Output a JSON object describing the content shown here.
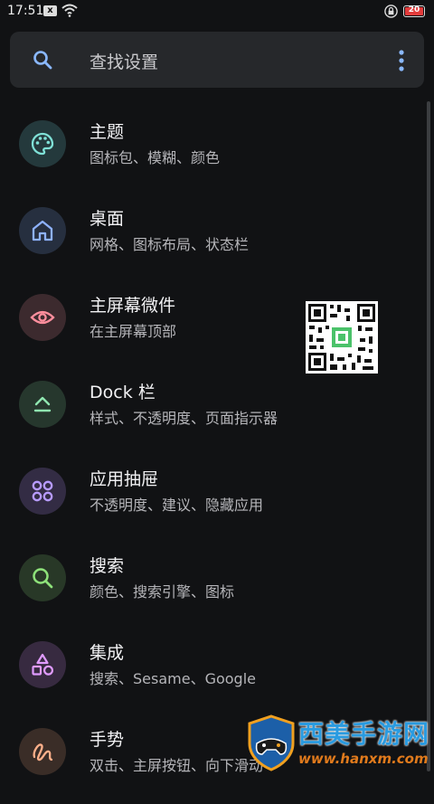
{
  "status_bar": {
    "time": "17:51",
    "notif_badge": "x",
    "battery": "20"
  },
  "search": {
    "placeholder": "查找设置"
  },
  "items": [
    {
      "title": "主题",
      "subtitle": "图标包、模糊、颜色",
      "icon": "palette-icon",
      "bg": "#24393c",
      "fg": "#7fe0d6"
    },
    {
      "title": "桌面",
      "subtitle": "网格、图标布局、状态栏",
      "icon": "home-icon",
      "bg": "#262f3f",
      "fg": "#8eb2ff"
    },
    {
      "title": "主屏幕微件",
      "subtitle": "在主屏幕顶部",
      "icon": "eye-icon",
      "bg": "#3c2a2e",
      "fg": "#ff8e9d"
    },
    {
      "title": "Dock 栏",
      "subtitle": "样式、不透明度、页面指示器",
      "icon": "dock-icon",
      "bg": "#26372d",
      "fg": "#8fe6b0"
    },
    {
      "title": "应用抽屉",
      "subtitle": "不透明度、建议、隐藏应用",
      "icon": "grid-icon",
      "bg": "#332c44",
      "fg": "#b79bff"
    },
    {
      "title": "搜索",
      "subtitle": "颜色、搜索引擎、图标",
      "icon": "search-icon",
      "bg": "#283827",
      "fg": "#8ee27a"
    },
    {
      "title": "集成",
      "subtitle": "搜索、Sesame、Google",
      "icon": "shapes-icon",
      "bg": "#372a40",
      "fg": "#e09bff"
    },
    {
      "title": "手势",
      "subtitle": "双击、主屏按钮、向下滑动",
      "icon": "gesture-icon",
      "bg": "#3a2d27",
      "fg": "#ffb08a"
    }
  ],
  "watermark": {
    "title": "西美手游网",
    "url": "www.hanxm.com"
  }
}
